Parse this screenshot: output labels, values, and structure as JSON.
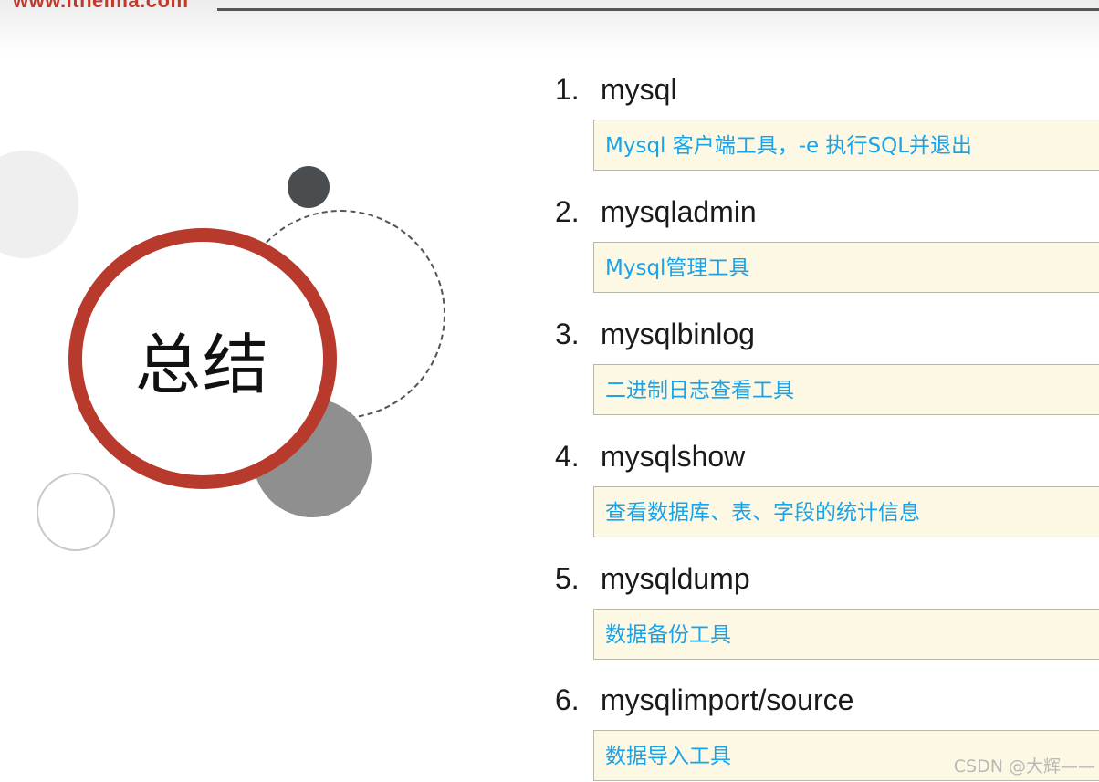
{
  "header": {
    "site_url": "www.itheima.com"
  },
  "title": "总结",
  "items": [
    {
      "number": "1.",
      "name": "mysql",
      "description": "Mysql 客户端工具，-e 执行SQL并退出"
    },
    {
      "number": "2.",
      "name": "mysqladmin",
      "description": "Mysql管理工具"
    },
    {
      "number": "3.",
      "name": "mysqlbinlog",
      "description": "二进制日志查看工具"
    },
    {
      "number": "4.",
      "name": "mysqlshow",
      "description": "查看数据库、表、字段的统计信息"
    },
    {
      "number": "5.",
      "name": "mysqldump",
      "description": "数据备份工具"
    },
    {
      "number": "6.",
      "name": "mysqlimport/source",
      "description": "数据导入工具"
    }
  ],
  "watermark": "CSDN @大辉——",
  "colors": {
    "accent_red": "#b83a2d",
    "desc_text": "#1aa3e8",
    "desc_bg": "#fdf8e3"
  }
}
